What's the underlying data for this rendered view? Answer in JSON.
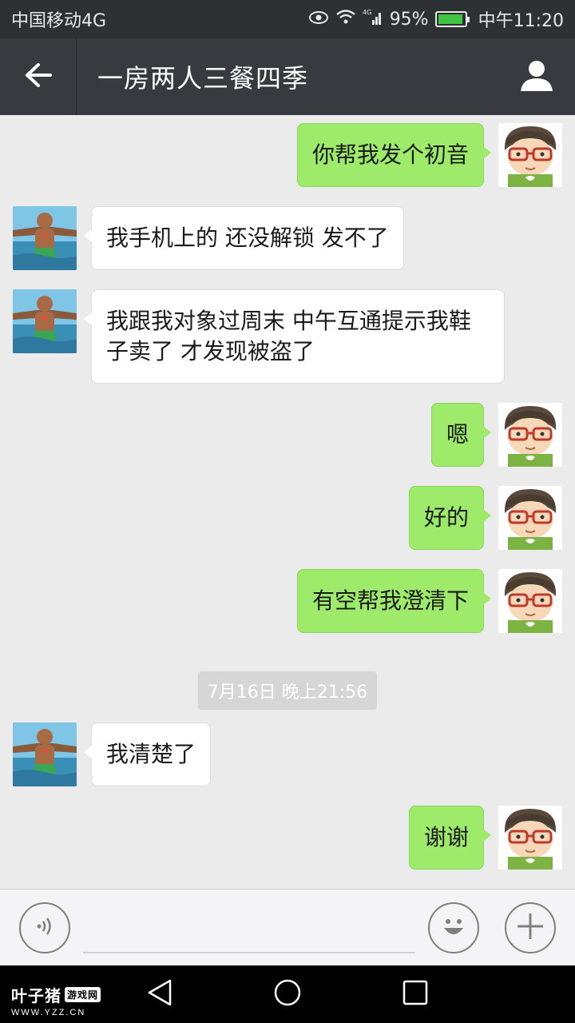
{
  "status_bar": {
    "carrier": "中国移动4G",
    "network": "4G",
    "battery": "95%",
    "battery_level": 0.95,
    "time": "中午11:20"
  },
  "header": {
    "title": "一房两人三餐四季",
    "back_icon": "arrow-left-icon",
    "profile_icon": "person-icon",
    "background": "#393a3f"
  },
  "messages": [
    {
      "side": "right",
      "text": "你帮我发个初音"
    },
    {
      "side": "left",
      "text": "我手机上的 还没解锁 发不了"
    },
    {
      "side": "left",
      "text": "我跟我对象过周末 中午互通提示我鞋子卖了 才发现被盗了"
    },
    {
      "side": "right",
      "text": "嗯"
    },
    {
      "side": "right",
      "text": "好的"
    },
    {
      "side": "right",
      "text": "有空帮我澄清下"
    },
    {
      "type": "time",
      "text": "7月16日 晚上21:56"
    },
    {
      "side": "left",
      "text": "我清楚了"
    },
    {
      "side": "right",
      "text": "谢谢"
    }
  ],
  "colors": {
    "sent_bubble": "#9eea6a",
    "received_bubble": "#ffffff",
    "chat_background": "#ebebeb"
  },
  "input_bar": {
    "voice_icon": "voice-icon",
    "emoji_icon": "emoji-icon",
    "plus_icon": "plus-icon",
    "placeholder": ""
  },
  "watermark": {
    "main": "叶子猪",
    "badge": "游戏网",
    "sub": "WWW.YZZ.CN"
  },
  "nav_bar": {
    "back_icon": "triangle-back-icon",
    "home_icon": "circle-home-icon",
    "recents_icon": "square-recents-icon"
  }
}
